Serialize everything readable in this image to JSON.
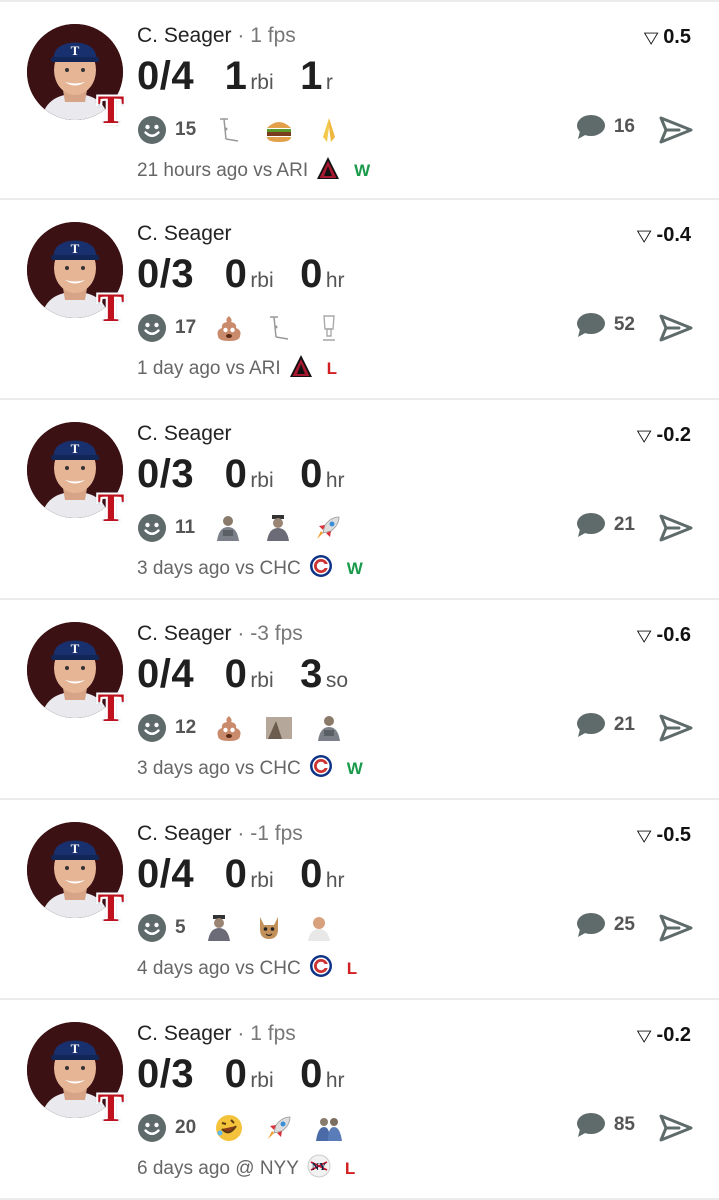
{
  "cards": [
    {
      "name": "C. Seager",
      "fps_text": " · 1 fps",
      "hits": "0/4",
      "stat2_value": "1",
      "stat2_unit": "rbi",
      "stat3_value": "1",
      "stat3_unit": "r",
      "score": "0.5",
      "reaction_count": "15",
      "reactions": [
        "crutch",
        "burger",
        "pray"
      ],
      "comments": "16",
      "time": "21 hours ago",
      "vs": "vs ARI",
      "result": "W",
      "opponent": "ari"
    },
    {
      "name": "C. Seager",
      "fps_text": "",
      "hits": "0/3",
      "stat2_value": "0",
      "stat2_unit": "rbi",
      "stat3_value": "0",
      "stat3_unit": "hr",
      "score": "-0.4",
      "reaction_count": "17",
      "reactions": [
        "poop",
        "crutch",
        "trophy"
      ],
      "comments": "52",
      "time": "1 day ago",
      "vs": "vs ARI",
      "result": "L",
      "opponent": "ari"
    },
    {
      "name": "C. Seager",
      "fps_text": "",
      "hits": "0/3",
      "stat2_value": "0",
      "stat2_unit": "rbi",
      "stat3_value": "0",
      "stat3_unit": "hr",
      "score": "-0.2",
      "reaction_count": "11",
      "reactions": [
        "person-a",
        "person-b",
        "rocket"
      ],
      "comments": "21",
      "time": "3 days ago",
      "vs": "vs CHC",
      "result": "W",
      "opponent": "chc"
    },
    {
      "name": "C. Seager",
      "fps_text": " · -3 fps",
      "hits": "0/4",
      "stat2_value": "0",
      "stat2_unit": "rbi",
      "stat3_value": "3",
      "stat3_unit": "so",
      "score": "-0.6",
      "reaction_count": "12",
      "reactions": [
        "poop",
        "person-c",
        "person-a"
      ],
      "comments": "21",
      "time": "3 days ago",
      "vs": "vs CHC",
      "result": "W",
      "opponent": "chc"
    },
    {
      "name": "C. Seager",
      "fps_text": " · -1 fps",
      "hits": "0/4",
      "stat2_value": "0",
      "stat2_unit": "rbi",
      "stat3_value": "0",
      "stat3_unit": "hr",
      "score": "-0.5",
      "reaction_count": "5",
      "reactions": [
        "person-b",
        "cat",
        "person-d"
      ],
      "comments": "25",
      "time": "4 days ago",
      "vs": "vs CHC",
      "result": "L",
      "opponent": "chc"
    },
    {
      "name": "C. Seager",
      "fps_text": " · 1 fps",
      "hits": "0/3",
      "stat2_value": "0",
      "stat2_unit": "rbi",
      "stat3_value": "0",
      "stat3_unit": "hr",
      "score": "-0.2",
      "reaction_count": "20",
      "reactions": [
        "laugh",
        "rocket",
        "person-e"
      ],
      "comments": "85",
      "time": "6 days ago",
      "vs": "@ NYY",
      "result": "L",
      "opponent": "nyy"
    }
  ],
  "colors": {
    "win": "#1a9a4a",
    "loss": "#d21f24",
    "icon_gray": "#5f6b6b"
  }
}
